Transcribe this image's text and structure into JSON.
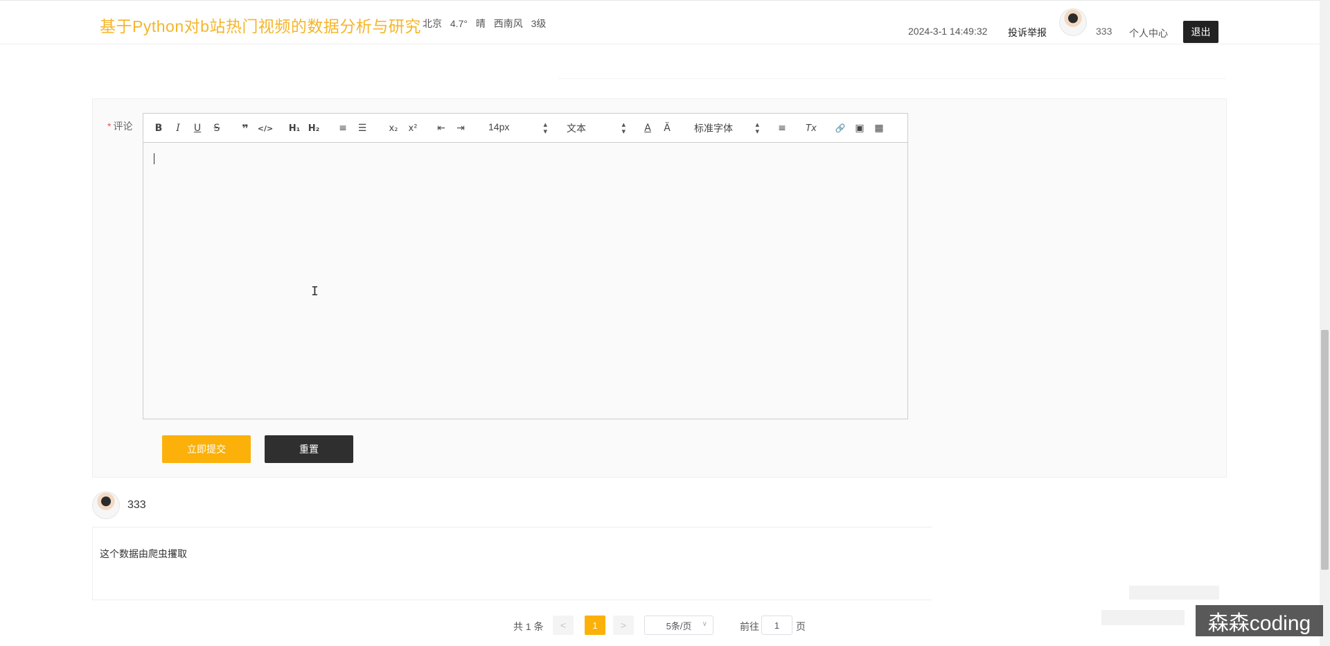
{
  "header": {
    "site_title": "基于Python对b站热门视频的数据分析与研究",
    "weather": {
      "city": "北京",
      "temp": "4.7°",
      "condition": "晴",
      "wind": "西南风",
      "level": "3级"
    },
    "datetime": "2024-3-1 14:49:32",
    "report_label": "投诉举报",
    "username": "333",
    "personal_center_label": "个人中心",
    "logout_label": "退出"
  },
  "form": {
    "comment_label": "评论",
    "required_mark": "*",
    "toolbar": {
      "bold": "B",
      "italic": "I",
      "underline": "U",
      "strike": "S",
      "quote": "❞",
      "code": "</>",
      "h1": "H₁",
      "h2": "H₂",
      "ordered": "≡",
      "bullet": "☰",
      "sub": "x₂",
      "sup": "x²",
      "outdent": "⇤",
      "indent": "⇥",
      "size_value": "14px",
      "header_value": "文本",
      "color": "A",
      "bg": "Ä",
      "font_value": "标准字体",
      "align": "≡",
      "clean": "Tx",
      "link": "🔗",
      "image": "▣",
      "video": "▦"
    },
    "submit_label": "立即提交",
    "reset_label": "重置"
  },
  "comment": {
    "username": "333",
    "text": "这个数据由爬虫攫取"
  },
  "pagination": {
    "total_label": "共 1 条",
    "prev": "<",
    "current_page": "1",
    "next": ">",
    "page_size": "5条/页",
    "goto_label": "前往",
    "goto_value": "1",
    "page_unit": "页"
  },
  "watermark": "森森coding"
}
